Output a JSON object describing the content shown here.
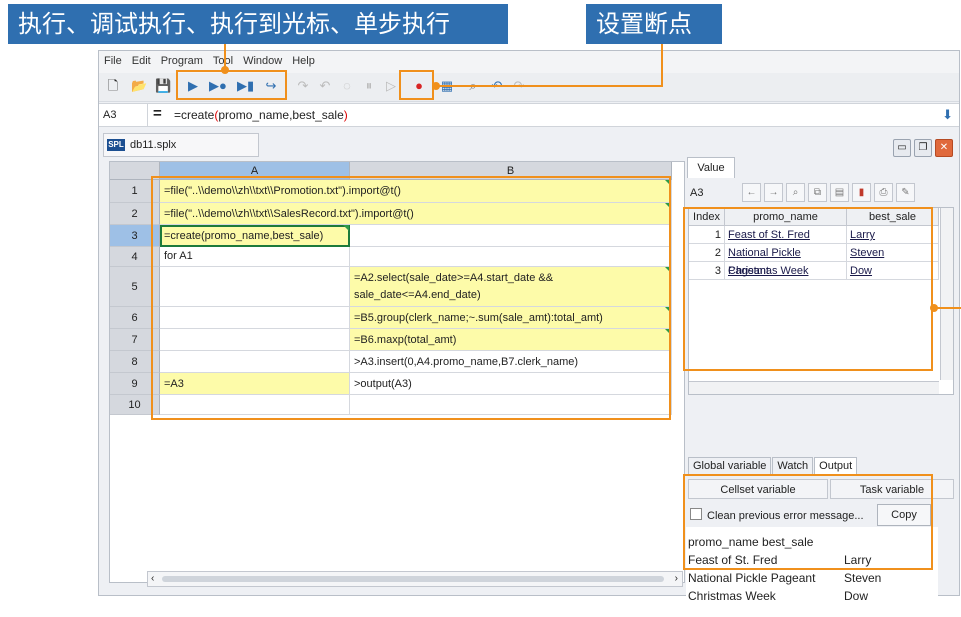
{
  "banners": {
    "left": "执行、调试执行、执行到光标、单步执行",
    "right": "设置断点"
  },
  "menu": [
    "File",
    "Edit",
    "Program",
    "Tool",
    "Window",
    "Help"
  ],
  "formula": {
    "cell": "A3",
    "eq": "=",
    "prefix": "=create",
    "open": "(",
    "args": "promo_name,best_sale",
    "close": ")"
  },
  "document": {
    "tab": "db11.splx",
    "icon": "SPL"
  },
  "grid": {
    "columns": [
      "A",
      "B"
    ],
    "rows": [
      "1",
      "2",
      "3",
      "4",
      "5",
      "6",
      "7",
      "8",
      "9",
      "10"
    ],
    "cells": {
      "a1": "=file(\"..\\\\demo\\\\zh\\\\txt\\\\Promotion.txt\").import@t()",
      "a2": "=file(\"..\\\\demo\\\\zh\\\\txt\\\\SalesRecord.txt\").import@t()",
      "a3": "=create(promo_name,best_sale)",
      "a4": "for A1",
      "b5": "=A2.select(sale_date>=A4.start_date && sale_date<=A4.end_date)",
      "b6": "=B5.group(clerk_name;~.sum(sale_amt):total_amt)",
      "b7": "=B6.maxp(total_amt)",
      "b8": ">A3.insert(0,A4.promo_name,B7.clerk_name)",
      "a9": "=A3",
      "b9": ">output(A3)"
    }
  },
  "value_panel": {
    "tab": "Value",
    "cell": "A3",
    "columns": [
      "Index",
      "promo_name",
      "best_sale"
    ],
    "rows": [
      {
        "index": "1",
        "promo_name": "Feast of St. Fred",
        "best_sale": "Larry"
      },
      {
        "index": "2",
        "promo_name": "National Pickle Pageant",
        "best_sale": "Steven"
      },
      {
        "index": "3",
        "promo_name": "Christmas Week",
        "best_sale": "Dow"
      }
    ]
  },
  "bottom_tabs": [
    "Global variable",
    "Watch",
    "Output"
  ],
  "var_tabs": [
    "Cellset variable",
    "Task variable"
  ],
  "error_check": "Clean previous error message...",
  "copy": "Copy",
  "output": {
    "header": "promo_name best_sale",
    "rows": [
      {
        "name": "Feast of St. Fred",
        "sale": "Larry"
      },
      {
        "name": "National Pickle Pageant",
        "sale": "Steven"
      },
      {
        "name": "Christmas Week",
        "sale": "Dow"
      }
    ]
  }
}
